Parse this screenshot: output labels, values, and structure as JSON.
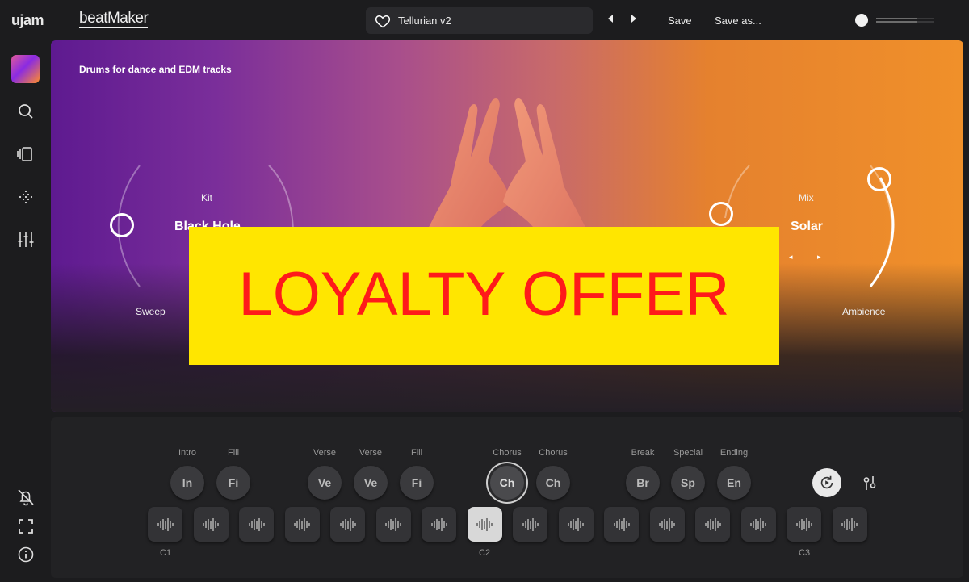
{
  "header": {
    "brand": "ujam",
    "product": "beatMaker",
    "preset_name": "Tellurian v2",
    "save_label": "Save",
    "save_as_label": "Save as..."
  },
  "hero": {
    "description": "Drums for dance and EDM tracks",
    "kit_title": "Kit",
    "kit_value": "Black Hole",
    "mix_title": "Mix",
    "mix_value": "Solar",
    "sweep_label": "Sweep",
    "ambience_label": "Ambience"
  },
  "overlay": {
    "text": "LOYALTY OFFER",
    "bg_color": "#ffe600",
    "text_color": "#ff1a1a"
  },
  "sections": {
    "labels": [
      "Intro",
      "Fill",
      "Verse",
      "Verse",
      "Fill",
      "Chorus",
      "Chorus",
      "Break",
      "Special",
      "Ending"
    ],
    "pads": [
      "In",
      "Fi",
      "Ve",
      "Ve",
      "Fi",
      "Ch",
      "Ch",
      "Br",
      "Sp",
      "En"
    ],
    "active_pad": 5
  },
  "keys": {
    "labels": [
      "C1",
      "C2",
      "C3"
    ],
    "count": 16,
    "active_index": 7
  },
  "colors": {
    "hero_start": "#5e1a90",
    "hero_end": "#f0902a"
  }
}
